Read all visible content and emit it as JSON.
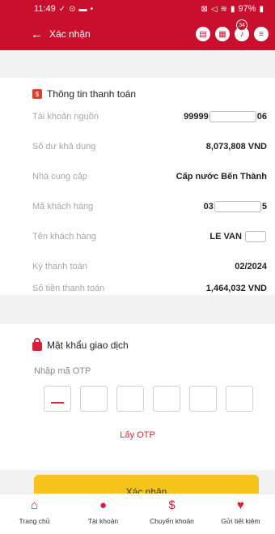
{
  "status_bar": {
    "time": "11:49",
    "battery": "97%"
  },
  "header": {
    "back_symbol": "←",
    "title": "Xác nhận",
    "notification_count": "34"
  },
  "payment_info": {
    "section_title": "Thông tin thanh toán",
    "rows": [
      {
        "label": "Tài khoản nguồn",
        "value_prefix": "99999",
        "value_suffix": "06"
      },
      {
        "label": "Số dư khả dụng",
        "value": "8,073,808 VND"
      },
      {
        "label": "Nhà cung cấp",
        "value": "Cấp nước Bến Thành"
      },
      {
        "label": "Mã khách hàng",
        "value_prefix": "03",
        "value_suffix": "5"
      },
      {
        "label": "Tên khách hàng",
        "value_prefix": "LE VAN",
        "value_suffix": ""
      },
      {
        "label": "Kỳ thanh toán",
        "value": "02/2024"
      },
      {
        "label": "Số tiền thanh toán",
        "value": "1,464,032 VND"
      }
    ]
  },
  "otp": {
    "section_title": "Mật khẩu giao dịch",
    "input_label": "Nhập mã OTP",
    "box_count": 6,
    "get_otp_label": "Lấy OTP"
  },
  "confirm_button": {
    "label": "Xác nhận"
  },
  "tabbar": {
    "items": [
      {
        "label": "Trang chủ",
        "icon": "home-icon"
      },
      {
        "label": "Tài khoản",
        "icon": "user-icon"
      },
      {
        "label": "Chuyển khoản",
        "icon": "transfer-icon"
      },
      {
        "label": "Gửi tiết kiệm",
        "icon": "piggy-bank-icon"
      }
    ]
  },
  "colors": {
    "brand": "#c8102e",
    "accent_button": "#f6c31a",
    "icon_red": "#d81e34"
  }
}
